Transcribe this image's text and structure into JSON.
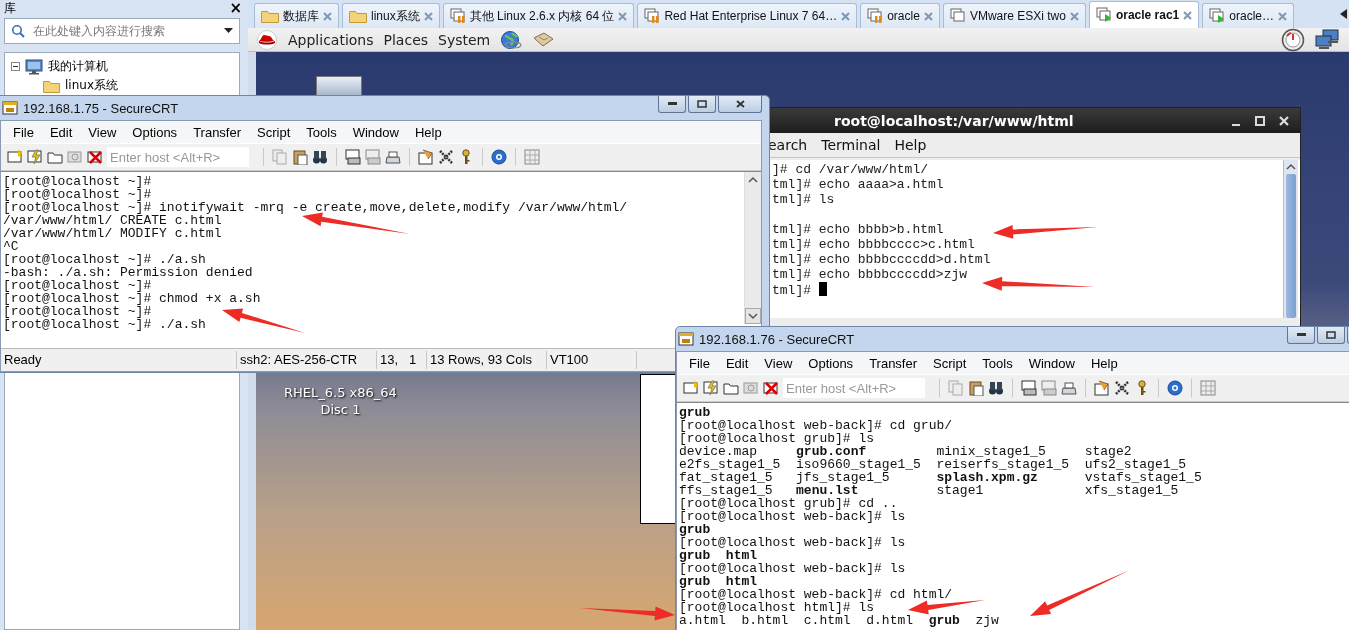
{
  "library": {
    "title": "库",
    "close": "×",
    "search": {
      "placeholder": "在此处键入内容进行搜索"
    },
    "tree": [
      {
        "label": "我的计算机",
        "expanded": true,
        "children": [
          {
            "label": "linux系统"
          }
        ]
      }
    ]
  },
  "vm_tabs": [
    {
      "label": "数据库",
      "kind": "folder",
      "selected": false
    },
    {
      "label": "linux系统",
      "kind": "folder",
      "selected": false
    },
    {
      "label": "其他 Linux 2.6.x 内核 64 位",
      "kind": "paused",
      "selected": false
    },
    {
      "label": "Red Hat Enterprise Linux 7 64…",
      "kind": "paused",
      "selected": false
    },
    {
      "label": "oracle",
      "kind": "paused",
      "selected": false
    },
    {
      "label": "VMware ESXi two",
      "kind": "off",
      "selected": false
    },
    {
      "label": "oracle rac1",
      "kind": "running",
      "selected": true
    },
    {
      "label": "oracle…",
      "kind": "running",
      "selected": false
    }
  ],
  "gnome_panel": {
    "menus": [
      "Applications",
      "Places",
      "System"
    ]
  },
  "desktop_icon": {
    "label_lines": [
      "RHEL_6.5 x86_64",
      "Disc 1"
    ]
  },
  "terminal": {
    "title": "root@localhost:/var/www/html",
    "menus": [
      "earch",
      "Terminal",
      "Help"
    ],
    "lines": [
      {
        "kind": "output",
        "text": "]# cd /var/www/html/"
      },
      {
        "kind": "output",
        "text": "tml]# echo aaaa>a.html"
      },
      {
        "kind": "output",
        "text": "tml]# ls"
      },
      {
        "kind": "blank"
      },
      {
        "kind": "output",
        "text": "tml]# echo bbbb>b.html"
      },
      {
        "kind": "output",
        "text": "tml]# echo bbbbcccc>c.html"
      },
      {
        "kind": "output",
        "text": "tml]# echo bbbbccccdd>d.html"
      },
      {
        "kind": "output",
        "text": "tml]# echo bbbbccccdd>zjw"
      },
      {
        "kind": "cursor_line",
        "text": "tml]# "
      }
    ]
  },
  "securecrt_windows": [
    {
      "title": "192.168.1.75 - SecureCRT",
      "menus": [
        "File",
        "Edit",
        "View",
        "Options",
        "Transfer",
        "Script",
        "Tools",
        "Window",
        "Help"
      ],
      "host_field": {
        "placeholder": "Enter host <Alt+R>"
      },
      "lines": [
        "[root@localhost ~]#",
        "[root@localhost ~]#",
        "[root@localhost ~]# inotifywait -mrq -e create,move,delete,modify /var/www/html/",
        "/var/www/html/ CREATE c.html",
        "/var/www/html/ MODIFY c.html",
        "^C",
        "[root@localhost ~]# ./a.sh",
        "-bash: ./a.sh: Permission denied",
        "[root@localhost ~]#",
        "[root@localhost ~]# chmod +x a.sh",
        "[root@localhost ~]#",
        "[root@localhost ~]# ./a.sh"
      ],
      "status_bar": [
        "Ready",
        "ssh2: AES-256-CTR",
        "13,   1",
        "13 Rows, 93 Cols",
        "VT100"
      ]
    },
    {
      "title": "192.168.1.76 - SecureCRT",
      "menus": [
        "File",
        "Edit",
        "View",
        "Options",
        "Transfer",
        "Script",
        "Tools",
        "Window",
        "Help"
      ],
      "host_field": {
        "placeholder": "Enter host <Alt+R>"
      },
      "lines": [
        "**grub**",
        "[root@localhost web-back]# cd grub/",
        "[root@localhost grub]# ls",
        "device.map     **grub.conf**         minix_stage1_5     stage2",
        "e2fs_stage1_5  iso9660_stage1_5  reiserfs_stage1_5  ufs2_stage1_5",
        "fat_stage1_5   jfs_stage1_5      **splash.xpm.gz**      vstafs_stage1_5",
        "ffs_stage1_5   **menu.lst**          stage1             xfs_stage1_5",
        "[root@localhost grub]# cd ..",
        "[root@localhost web-back]# ls",
        "**grub**",
        "[root@localhost web-back]# ls",
        "**grub**  **html**",
        "[root@localhost web-back]# ls",
        "**grub**  **html**",
        "[root@localhost web-back]# cd html/",
        "[root@localhost html]# ls",
        "a.html  b.html  c.html  d.html  **grub**  zjw"
      ]
    }
  ]
}
